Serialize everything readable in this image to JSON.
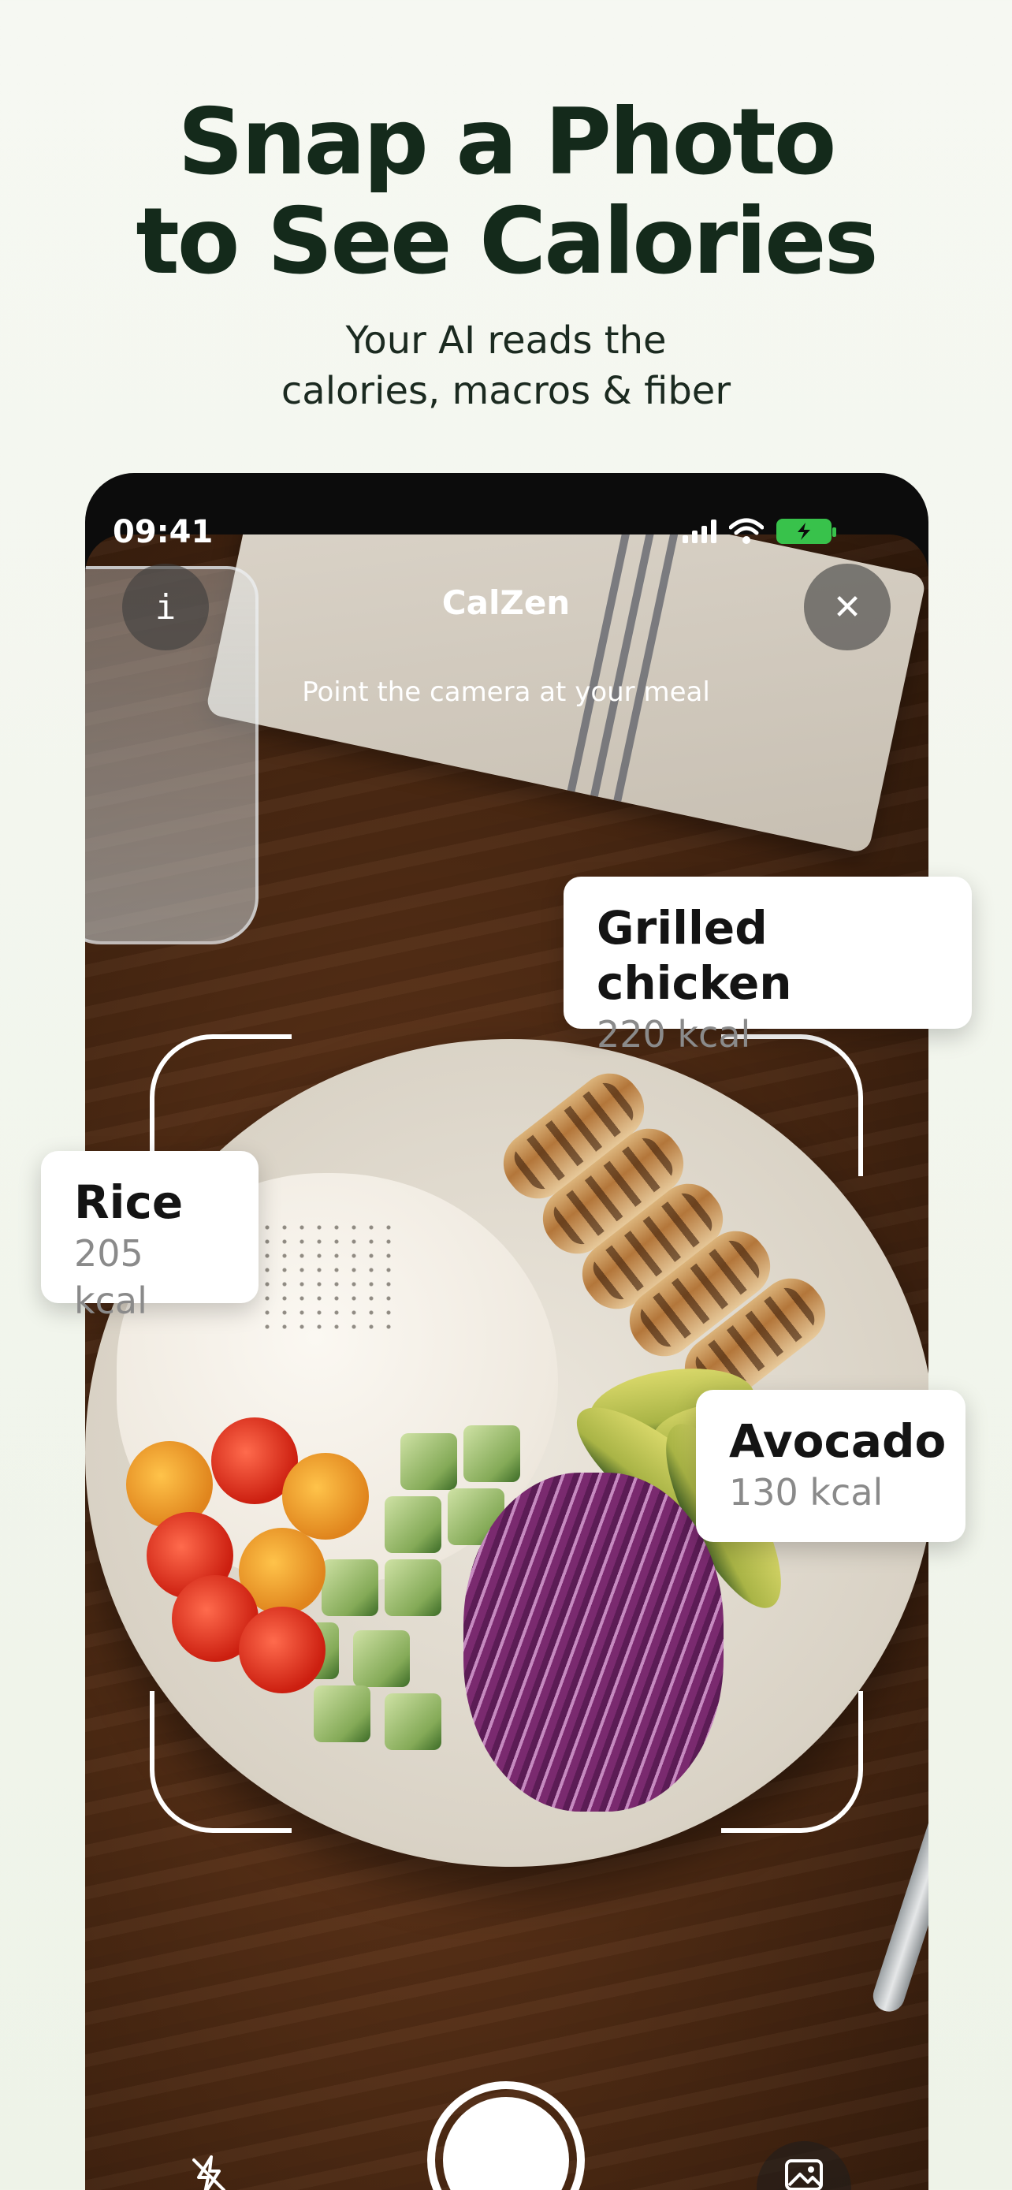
{
  "promo": {
    "headline": [
      "Snap a Photo",
      "to See Calories"
    ],
    "subline": [
      "Your AI reads the",
      "calories, macros & fiber"
    ]
  },
  "status_bar": {
    "time": "09:41"
  },
  "camera": {
    "app_title": "CalZen",
    "info_label": "i",
    "close_label": "✕",
    "hint": "Point the camera at your meal"
  },
  "detections": [
    {
      "name": "Grilled chicken",
      "kcal": "220 kcal"
    },
    {
      "name": "Rice",
      "kcal": "205 kcal"
    },
    {
      "name": "Avocado",
      "kcal": "130 kcal"
    }
  ],
  "controls": {
    "flash_icon": "flash-off-icon",
    "shutter": "shutter-button",
    "gallery_icon": "gallery-icon"
  },
  "colors": {
    "headline": "#142a1b",
    "background": "#f3f6ef",
    "battery": "#38c24b",
    "card_bg": "#ffffff",
    "kcal_text": "#8a8a8a"
  }
}
